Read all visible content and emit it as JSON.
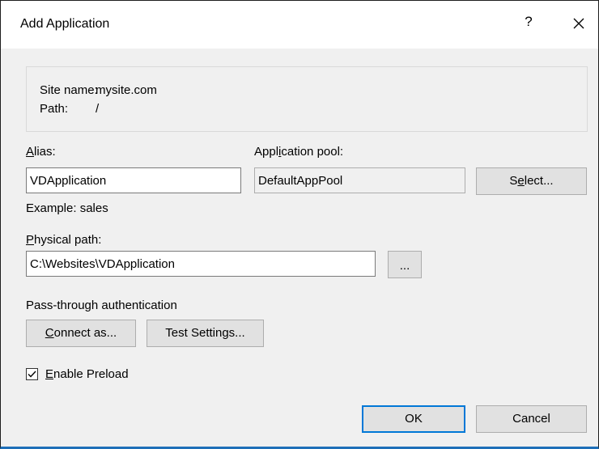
{
  "window": {
    "title": "Add Application",
    "help_label": "?"
  },
  "info": {
    "site_name_label": "Site name:",
    "site_name_value": "mysite.com",
    "path_label": "Path:",
    "path_value": "/"
  },
  "alias": {
    "label_mnemonic": "A",
    "label_rest": "lias:",
    "value": "VDApplication",
    "example": "Example: sales"
  },
  "app_pool": {
    "label_pre": "Appl",
    "label_mnemonic": "i",
    "label_post": "cation pool:",
    "value": "DefaultAppPool",
    "select_pre": "S",
    "select_mnemonic": "e",
    "select_post": "lect..."
  },
  "physical_path": {
    "label_mnemonic": "P",
    "label_rest": "hysical path:",
    "value": "C:\\Websites\\VDApplication",
    "browse_label": "..."
  },
  "auth": {
    "heading": "Pass-through authentication",
    "connect_mnemonic": "C",
    "connect_rest": "onnect as...",
    "test_label": "Test Settings..."
  },
  "preload": {
    "checked": true,
    "label_mnemonic": "E",
    "label_rest": "nable Preload"
  },
  "footer": {
    "ok_label": "OK",
    "cancel_label": "Cancel"
  }
}
